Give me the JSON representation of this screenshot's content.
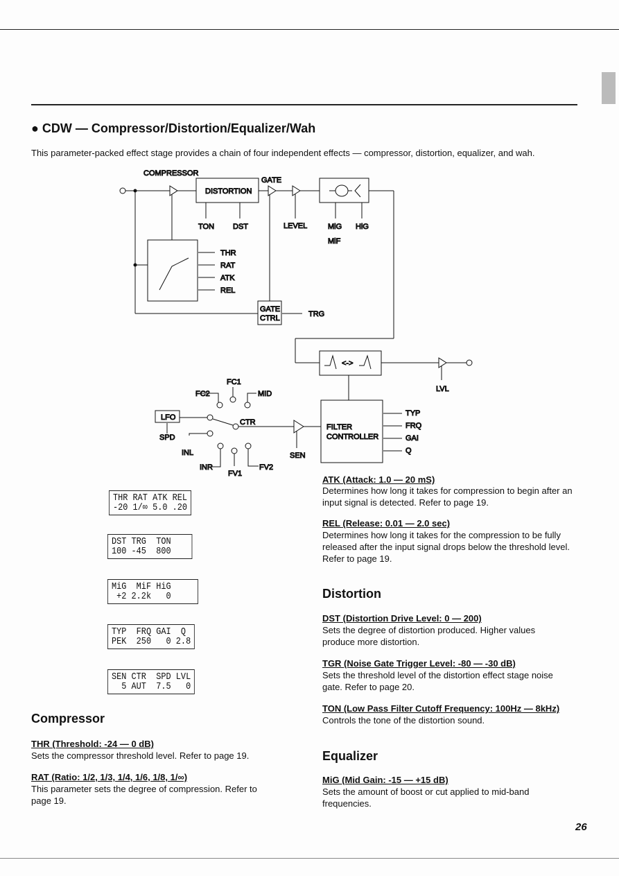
{
  "section": {
    "title": "● CDW — Compressor/Distortion/Equalizer/Wah",
    "intro": "This parameter-packed effect stage provides a chain of four independent effects — compressor, distortion, equalizer, and wah."
  },
  "diagram": {
    "compressor": "COMPRESSOR",
    "distortion": "DISTORTION",
    "gate": "GATE",
    "ton": "TON",
    "dst": "DST",
    "level": "LEVEL",
    "mig": "MiG",
    "hig": "HiG",
    "mif": "MiF",
    "thr": "THR",
    "rat": "RAT",
    "atk": "ATK",
    "rel": "REL",
    "gate_ctrl_1": "GATE",
    "gate_ctrl_2": "CTRL",
    "trg": "TRG",
    "lvl": "LVL",
    "fc1": "FC1",
    "fc2": "FC2",
    "mid": "MID",
    "lfo": "LFO",
    "ctr": "CTR",
    "spd": "SPD",
    "inl": "INL",
    "inr": "INR",
    "fv1": "FV1",
    "fv2": "FV2",
    "sen": "SEN",
    "filter_1": "FILTER",
    "filter_2": "CONTROLLER",
    "typ": "TYP",
    "frq": "FRQ",
    "gai": "GAI",
    "q": "Q"
  },
  "lcds": [
    {
      "line1": "THR RAT ATK REL",
      "line2": "-20 1/∞ 5.0 .20"
    },
    {
      "line1": "DST TRG  TON",
      "line2": "100 -45  800"
    },
    {
      "line1": "MiG  MiF HiG",
      "line2": " +2 2.2k   0"
    },
    {
      "line1": "TYP  FRQ GAI  Q",
      "line2": "PEK  250   0 2.8"
    },
    {
      "line1": "SEN CTR  SPD LVL",
      "line2": "  5 AUT  7.5   0"
    }
  ],
  "compressor": {
    "heading": "Compressor",
    "items": [
      {
        "title": "THR (Threshold: -24 — 0 dB)",
        "text": "Sets the compressor threshold level. Refer to page 19."
      },
      {
        "title": "RAT (Ratio: 1/2, 1/3, 1/4, 1/6, 1/8, 1/∞)",
        "text": "This parameter sets the degree of compression.  Refer to page 19."
      }
    ]
  },
  "right_top": [
    {
      "title": "ATK (Attack: 1.0 — 20 mS)",
      "text": "Determines how long it takes for compression to begin after an input signal is detected.  Refer to page 19."
    },
    {
      "title": "REL (Release: 0.01 — 2.0 sec)",
      "text": "Determines how long it takes for the compression to be fully released after the input signal drops below the threshold level. Refer to page 19."
    }
  ],
  "distortion": {
    "heading": "Distortion",
    "items": [
      {
        "title": "DST (Distortion Drive Level: 0 — 200)",
        "text": "Sets the degree of distortion produced. Higher values produce more distortion."
      },
      {
        "title": "TGR (Noise Gate Trigger Level: -80 — -30 dB)",
        "text": "Sets the threshold level of the distortion effect stage noise gate. Refer to page 20."
      },
      {
        "title": "TON (Low Pass Filter Cutoff Frequency: 100Hz — 8kHz)",
        "text": "Controls the tone of the distortion sound."
      }
    ]
  },
  "equalizer": {
    "heading": "Equalizer",
    "items": [
      {
        "title": "MiG (Mid Gain: -15 — +15 dB)",
        "text": "Sets the amount of boost or cut applied to mid-band frequencies."
      }
    ]
  },
  "page_number": "26"
}
